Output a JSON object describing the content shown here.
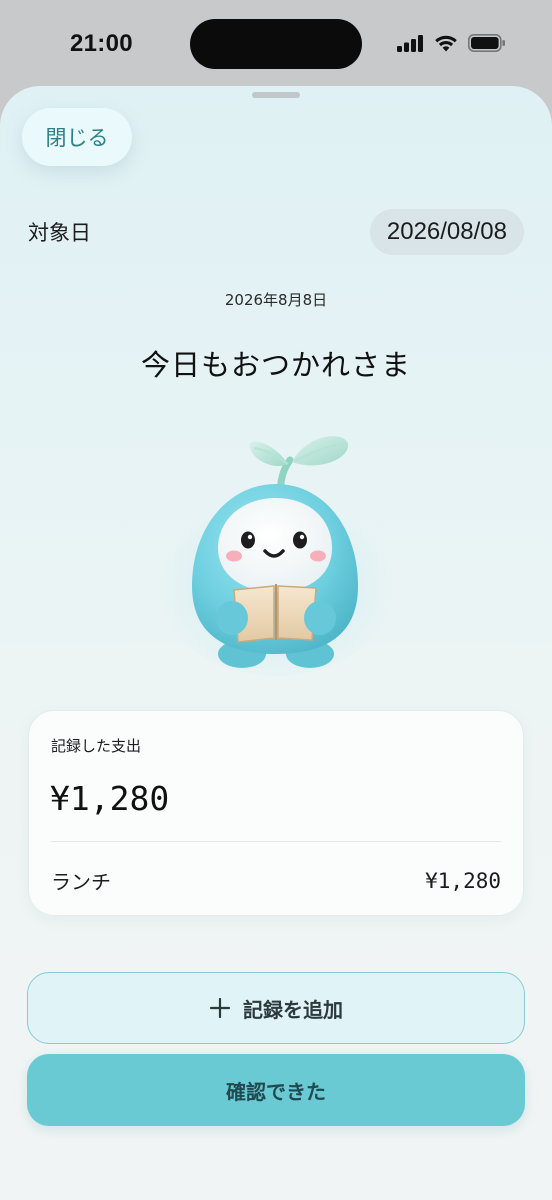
{
  "status_bar": {
    "time": "21:00",
    "icons": [
      "cellular-signal-icon",
      "wifi-icon",
      "battery-icon"
    ]
  },
  "sheet": {
    "close_label": "閉じる",
    "date_label": "対象日",
    "date_value": "2026/08/08",
    "date_caption": "2026年8月8日",
    "headline": "今日もおつかれさま"
  },
  "mascot": {
    "icon": "sprout-mascot-reading-book"
  },
  "expense_card": {
    "title": "記録した支出",
    "total": "¥1,280",
    "items": [
      {
        "label": "ランチ",
        "amount": "¥1,280"
      }
    ]
  },
  "actions": {
    "add_label": "記録を追加",
    "add_icon": "plus-icon",
    "confirm_label": "確認できた"
  },
  "colors": {
    "accent": "#69cad3",
    "accent_light": "#e0f3f6",
    "close_text": "#2f7f86",
    "mascot_body": "#6fd0e0"
  }
}
